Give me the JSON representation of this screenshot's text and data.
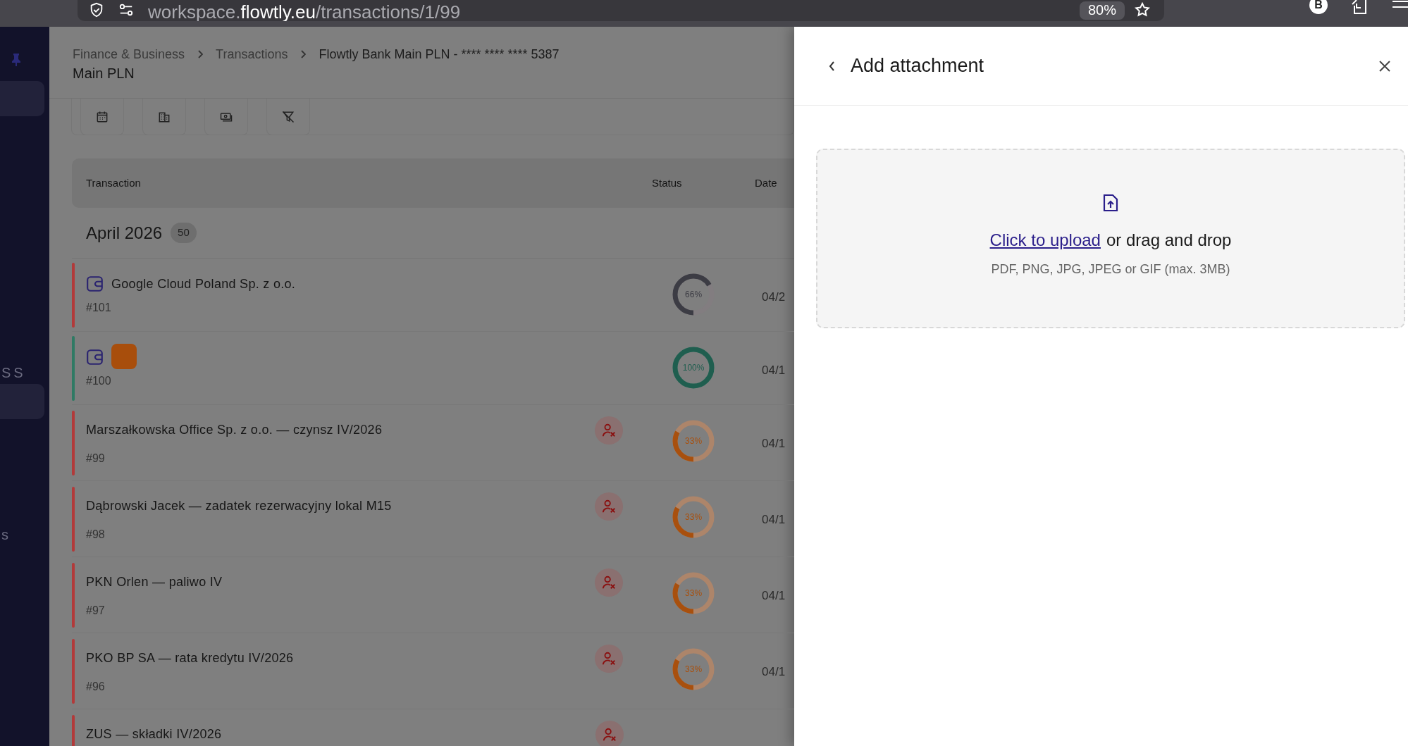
{
  "browser": {
    "url": {
      "subdomain": "workspace.",
      "domain": "flowtly.eu",
      "path": "/transactions/1/99"
    },
    "zoom": "80%",
    "avatar": "B"
  },
  "sidebar": {
    "items": [
      {
        "selected": true
      },
      {
        "selected": true
      }
    ],
    "labels": [
      "SS",
      "s"
    ]
  },
  "breadcrumb": [
    "Finance & Business",
    "Transactions",
    "Flowtly Bank Main PLN - **** **** **** 5387"
  ],
  "page_title": "Main PLN",
  "table": {
    "columns": [
      "Transaction",
      "Status",
      "Date"
    ],
    "group": {
      "label": "April 2026",
      "count": "50"
    },
    "rows": [
      {
        "title": "Google Cloud Poland Sp. z o.o.",
        "number": "#101",
        "color": "#b23a3a",
        "wallet": true,
        "logo": false,
        "unassigned": false,
        "status": {
          "label": "66%",
          "level": 0.66,
          "color": "#3c3c44"
        },
        "date": "04/2"
      },
      {
        "number": "#100",
        "color": "#2f7a64",
        "wallet": true,
        "logo": true,
        "unassigned": false,
        "status": {
          "label": "100%",
          "level": 1,
          "color": "#1f5e4f"
        },
        "date": "04/1"
      },
      {
        "title": "Marszałkowska Office Sp. z o.o. — czynsz IV/2026",
        "number": "#99",
        "color": "#b23a3a",
        "wallet": false,
        "logo": false,
        "unassigned": true,
        "status": {
          "label": "33%",
          "level": 0.33,
          "color": "#a8500e"
        },
        "date": "04/1"
      },
      {
        "title": "Dąbrowski Jacek — zadatek rezerwacyjny lokal M15",
        "number": "#98",
        "color": "#b23a3a",
        "wallet": false,
        "logo": false,
        "unassigned": true,
        "status": {
          "label": "33%",
          "level": 0.33,
          "color": "#a8500e"
        },
        "date": "04/1"
      },
      {
        "title": "PKN Orlen — paliwo IV",
        "number": "#97",
        "color": "#b23a3a",
        "wallet": false,
        "logo": false,
        "unassigned": true,
        "status": {
          "label": "33%",
          "level": 0.33,
          "color": "#a8500e"
        },
        "date": "04/1"
      },
      {
        "title": "PKO BP SA — rata kredytu IV/2026",
        "number": "#96",
        "color": "#b23a3a",
        "wallet": false,
        "logo": false,
        "unassigned": true,
        "status": {
          "label": "33%",
          "level": 0.33,
          "color": "#a8500e"
        },
        "date": "04/1"
      },
      {
        "title": "ZUS — składki IV/2026",
        "color": "#b23a3a",
        "wallet": false,
        "logo": false,
        "unassigned": true
      }
    ]
  },
  "panel": {
    "title": "Add attachment",
    "upload": {
      "link": "Click to upload",
      "text": "or drag and drop",
      "hint": "PDF, PNG, JPG, JPEG or GIF (max. 3MB)"
    }
  }
}
